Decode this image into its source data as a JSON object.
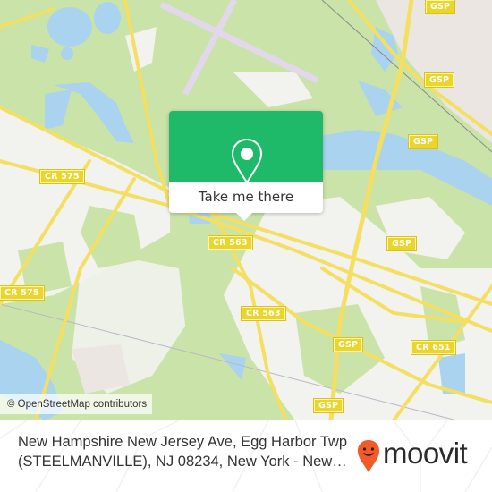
{
  "map": {
    "colors": {
      "forest": "#c9e3a8",
      "urban": "#f2f2ee",
      "water": "#a9d3ee",
      "road": "#f4df63",
      "airport_runway": "#e3d7ec",
      "commercial": "#ece6e3"
    },
    "road_shields": [
      {
        "label": "CR 575"
      },
      {
        "label": "CR 575"
      },
      {
        "label": "CR 563"
      },
      {
        "label": "CR 563"
      },
      {
        "label": "GSP"
      },
      {
        "label": "GSP"
      },
      {
        "label": "GSP"
      },
      {
        "label": "GSP"
      },
      {
        "label": "GSP"
      },
      {
        "label": "GSP"
      },
      {
        "label": "CR 651"
      }
    ],
    "attribution": "© OpenStreetMap contributors"
  },
  "popup": {
    "icon": "map-pin-icon",
    "button_label": "Take me there",
    "accent_color": "#1fb96a"
  },
  "footer": {
    "address_line1": "New Hampshire New Jersey Ave, Egg Harbor Twp",
    "address_line2": "(STEELMANVILLE), NJ 08234, New York - New…",
    "brand_name": "moovit",
    "brand_icon": "moovit-pin-logo-icon",
    "brand_color": "#f15a29"
  }
}
